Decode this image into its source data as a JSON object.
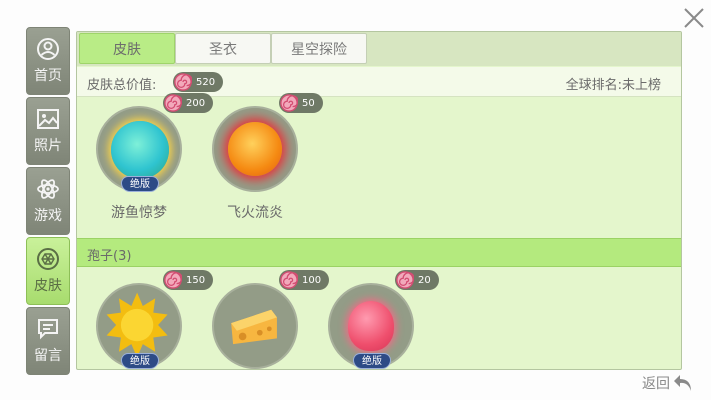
{
  "sidebar": {
    "items": [
      {
        "label": "首页",
        "icon": "user-icon"
      },
      {
        "label": "照片",
        "icon": "image-icon"
      },
      {
        "label": "游戏",
        "icon": "atom-icon"
      },
      {
        "label": "皮肤",
        "icon": "gem-icon",
        "active": true
      },
      {
        "label": "留言",
        "icon": "chat-icon"
      }
    ]
  },
  "tabs": [
    "皮肤",
    "圣衣",
    "星空探险"
  ],
  "summary": {
    "label": "皮肤总价值:",
    "total": "520",
    "rank": "全球排名:未上榜"
  },
  "group1": {
    "items": [
      {
        "name": "游鱼惊梦",
        "price": "200",
        "badge": "绝版",
        "color": "#38d6c5"
      },
      {
        "name": "飞火流炎",
        "price": "50",
        "color": "#f28a14"
      }
    ]
  },
  "group2": {
    "title": "孢子(3)",
    "items": [
      {
        "price": "150",
        "badge": "绝版",
        "color": "#f5c615"
      },
      {
        "price": "100",
        "color": "#f5b94a"
      },
      {
        "price": "20",
        "badge": "绝版",
        "color": "#ef4f6d"
      }
    ]
  },
  "back_label": "返回",
  "colors": {
    "accent": "#b4ea7e",
    "coin": "#e8577a",
    "pill": "#6f7966"
  }
}
